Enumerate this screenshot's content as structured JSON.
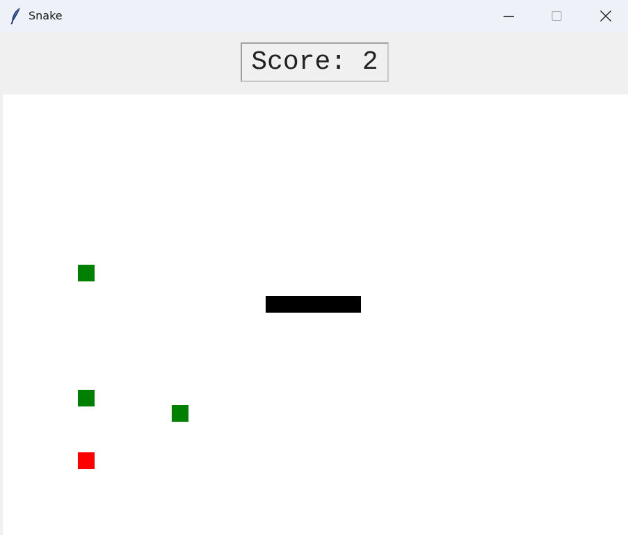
{
  "window": {
    "title": "Snake",
    "icon": "feather-icon",
    "controls": {
      "minimize_icon": "minimize-icon",
      "maximize_icon": "maximize-icon",
      "close_icon": "close-icon"
    }
  },
  "score": {
    "text": "Score: 2"
  },
  "colors": {
    "snake": "#000000",
    "green_item": "#008000",
    "red_item": "#ff0000",
    "background": "#ffffff",
    "panel": "#f0f0f0"
  }
}
